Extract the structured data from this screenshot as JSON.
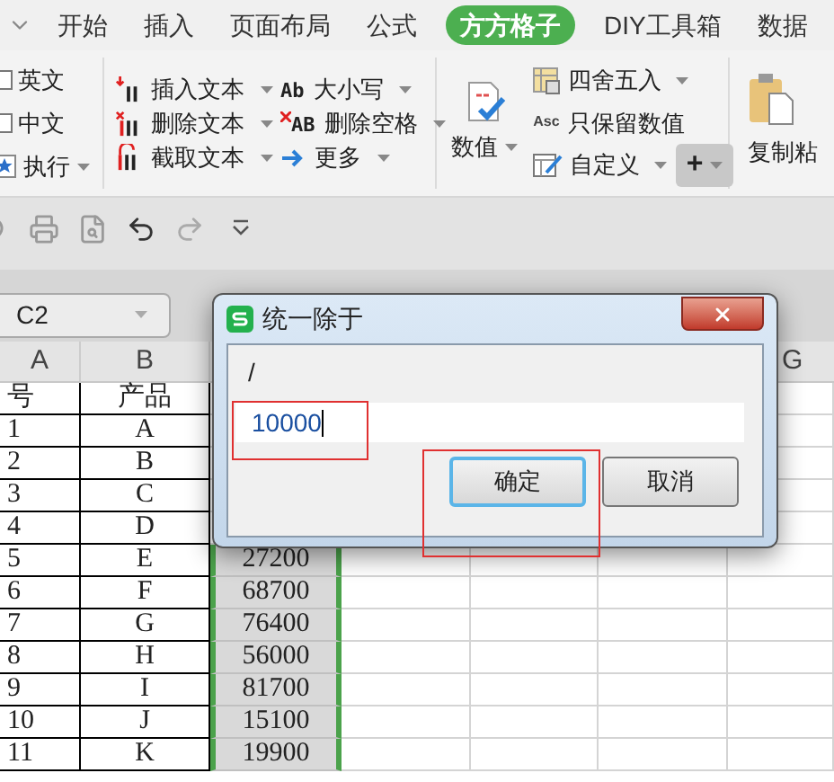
{
  "ribbon_tabs": [
    {
      "label": "开始",
      "selected": false
    },
    {
      "label": "插入",
      "selected": false
    },
    {
      "label": "页面布局",
      "selected": false
    },
    {
      "label": "公式",
      "selected": false
    },
    {
      "label": "方方格子",
      "selected": true
    },
    {
      "label": "DIY工具箱",
      "selected": false
    },
    {
      "label": "数据",
      "selected": false
    }
  ],
  "ribbon": {
    "checkbox_group": [
      {
        "kind": "checkbox",
        "label": "英文",
        "checked": false
      },
      {
        "kind": "checkbox",
        "label": "中文",
        "checked": false
      },
      {
        "kind": "menu",
        "label": "执行"
      }
    ],
    "text_tools": [
      {
        "label": "插入文本"
      },
      {
        "label": "删除文本"
      },
      {
        "label": "截取文本"
      },
      {
        "label": "大小写",
        "icon_text": "Ab"
      },
      {
        "label": "删除空格",
        "icon_text": "AB"
      },
      {
        "label": "更多"
      }
    ],
    "number_tools": {
      "main": "数值",
      "items": [
        {
          "label": "四舍五入",
          "dropdown": true
        },
        {
          "label": "只保留数值",
          "icon_text": "Asc",
          "dropdown": false
        },
        {
          "label": "自定义",
          "dropdown": true
        }
      ],
      "plus_button": "+"
    },
    "paste": "复制粘"
  },
  "name_box": "C2",
  "left_headers": [
    "A",
    "B"
  ],
  "right_header": "G",
  "header_row": {
    "no": "号",
    "product": "产品"
  },
  "rows": [
    {
      "no": "1",
      "product": "A"
    },
    {
      "no": "2",
      "product": "B"
    },
    {
      "no": "3",
      "product": "C"
    },
    {
      "no": "4",
      "product": "D"
    },
    {
      "no": "5",
      "product": "E",
      "amount": "27200",
      "selected": true
    },
    {
      "no": "6",
      "product": "F",
      "amount": "68700",
      "selected": true
    },
    {
      "no": "7",
      "product": "G",
      "amount": "76400",
      "selected": true
    },
    {
      "no": "8",
      "product": "H",
      "amount": "56000",
      "selected": true
    },
    {
      "no": "9",
      "product": "I",
      "amount": "81700",
      "selected": true
    },
    {
      "no": "10",
      "product": "J",
      "amount": "15100",
      "selected": true
    },
    {
      "no": "11",
      "product": "K",
      "amount": "19900",
      "selected": true
    }
  ],
  "dialog": {
    "title": "统一除于",
    "label": "/",
    "value": "10000",
    "buttons": [
      {
        "label": "确定",
        "focused": true
      },
      {
        "label": "取消",
        "focused": false
      }
    ]
  }
}
